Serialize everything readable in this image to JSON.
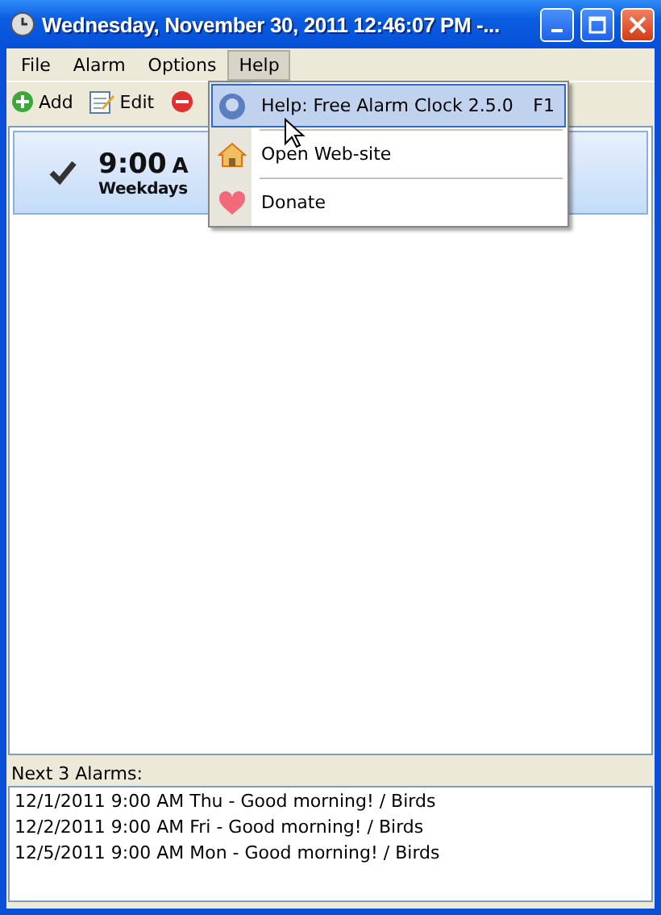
{
  "window": {
    "title": "Wednesday, November 30, 2011 12:46:07 PM -..."
  },
  "menu_bar": [
    {
      "label": "File",
      "selected": false
    },
    {
      "label": "Alarm",
      "selected": false
    },
    {
      "label": "Options",
      "selected": false
    },
    {
      "label": "Help",
      "selected": true
    }
  ],
  "toolbar": [
    {
      "kind": "add",
      "label": "Add"
    },
    {
      "kind": "edit",
      "label": "Edit"
    },
    {
      "kind": "delete"
    }
  ],
  "alarms": [
    {
      "time": "9:00",
      "suffix": "A",
      "repeat": "Weekdays",
      "checked": true,
      "selected": true
    }
  ],
  "next_alarms": {
    "label": "Next 3 Alarms:",
    "items": [
      "12/1/2011 9:00 AM Thu - Good morning! / Birds",
      "12/2/2011 9:00 AM Fri - Good morning! / Birds",
      "12/5/2011 9:00 AM Mon - Good morning! / Birds"
    ]
  },
  "help_menu": [
    {
      "kind": "help",
      "label": "Help: Free Alarm Clock 2.5.0",
      "shortcut": "F1",
      "selected": true
    },
    {
      "kind": "web",
      "label": "Open Web-site",
      "selected": false
    },
    {
      "kind": "donate",
      "label": "Donate",
      "selected": false
    }
  ]
}
